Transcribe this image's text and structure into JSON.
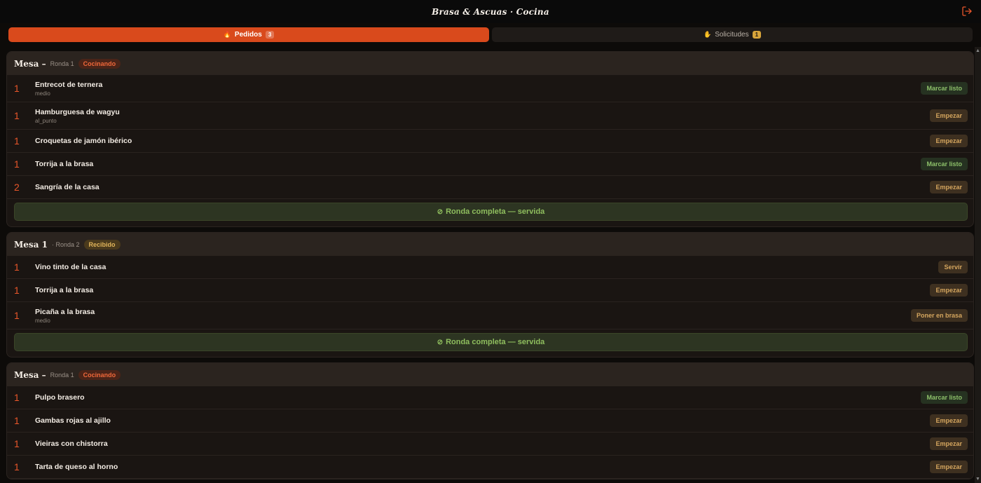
{
  "app": {
    "title": "Brasa & Ascuas · Cocina",
    "logout_icon": "logout-icon"
  },
  "tabs": [
    {
      "label": "Pedidos",
      "icon": "flame-icon",
      "count": "3",
      "active": true
    },
    {
      "label": "Solicitudes",
      "icon": "hand-icon",
      "count": "1",
      "active": false
    }
  ],
  "orders": [
    {
      "mesa": "Mesa –",
      "ronda": "Ronda 1",
      "status": "Cocinando",
      "status_kind": "cocinando",
      "items": [
        {
          "qty": "1",
          "name": "Entrecot de ternera",
          "note": "medio",
          "action": "Marcar listo",
          "action_kind": "ready"
        },
        {
          "qty": "1",
          "name": "Hamburguesa de wagyu",
          "note": "al_punto",
          "action": "Empezar",
          "action_kind": "start"
        },
        {
          "qty": "1",
          "name": "Croquetas de jamón ibérico",
          "note": "",
          "action": "Empezar",
          "action_kind": "start"
        },
        {
          "qty": "1",
          "name": "Torrija a la brasa",
          "note": "",
          "action": "Marcar listo",
          "action_kind": "ready"
        },
        {
          "qty": "2",
          "name": "Sangría de la casa",
          "note": "",
          "action": "Empezar",
          "action_kind": "start"
        }
      ],
      "footer": "Ronda completa — servida"
    },
    {
      "mesa": "Mesa 1",
      "ronda": "· Ronda 2",
      "status": "Recibido",
      "status_kind": "recibido",
      "items": [
        {
          "qty": "1",
          "name": "Vino tinto de la casa",
          "note": "",
          "action": "Servir",
          "action_kind": "start"
        },
        {
          "qty": "1",
          "name": "Torrija a la brasa",
          "note": "",
          "action": "Empezar",
          "action_kind": "start"
        },
        {
          "qty": "1",
          "name": "Picaña a la brasa",
          "note": "medio",
          "action": "Poner en brasa",
          "action_kind": "start"
        }
      ],
      "footer": "Ronda completa — servida"
    },
    {
      "mesa": "Mesa –",
      "ronda": "Ronda 1",
      "status": "Cocinando",
      "status_kind": "cocinando",
      "items": [
        {
          "qty": "1",
          "name": "Pulpo brasero",
          "note": "",
          "action": "Marcar listo",
          "action_kind": "ready"
        },
        {
          "qty": "1",
          "name": "Gambas rojas al ajillo",
          "note": "",
          "action": "Empezar",
          "action_kind": "start"
        },
        {
          "qty": "1",
          "name": "Vieiras con chistorra",
          "note": "",
          "action": "Empezar",
          "action_kind": "start"
        },
        {
          "qty": "1",
          "name": "Tarta de queso al horno",
          "note": "",
          "action": "Empezar",
          "action_kind": "start"
        }
      ],
      "footer": ""
    }
  ],
  "colors": {
    "accent": "#d94a1c",
    "ready": "#8dc06a",
    "pending": "#d4a55e"
  }
}
